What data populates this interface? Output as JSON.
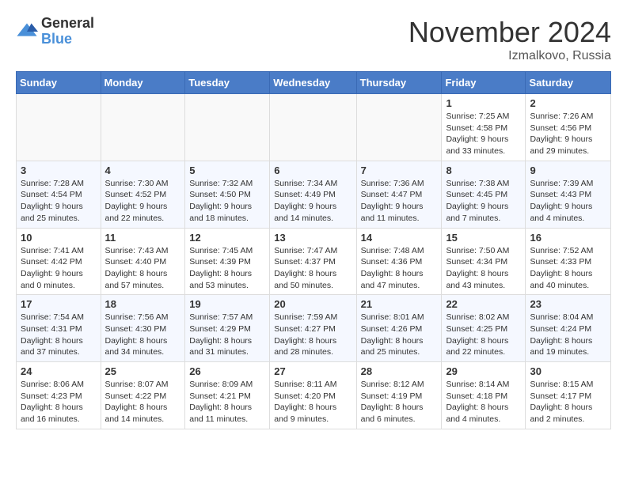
{
  "logo": {
    "general": "General",
    "blue": "Blue"
  },
  "title": "November 2024",
  "location": "Izmalkovo, Russia",
  "weekdays": [
    "Sunday",
    "Monday",
    "Tuesday",
    "Wednesday",
    "Thursday",
    "Friday",
    "Saturday"
  ],
  "weeks": [
    [
      {
        "day": "",
        "info": ""
      },
      {
        "day": "",
        "info": ""
      },
      {
        "day": "",
        "info": ""
      },
      {
        "day": "",
        "info": ""
      },
      {
        "day": "",
        "info": ""
      },
      {
        "day": "1",
        "info": "Sunrise: 7:25 AM\nSunset: 4:58 PM\nDaylight: 9 hours and 33 minutes."
      },
      {
        "day": "2",
        "info": "Sunrise: 7:26 AM\nSunset: 4:56 PM\nDaylight: 9 hours and 29 minutes."
      }
    ],
    [
      {
        "day": "3",
        "info": "Sunrise: 7:28 AM\nSunset: 4:54 PM\nDaylight: 9 hours and 25 minutes."
      },
      {
        "day": "4",
        "info": "Sunrise: 7:30 AM\nSunset: 4:52 PM\nDaylight: 9 hours and 22 minutes."
      },
      {
        "day": "5",
        "info": "Sunrise: 7:32 AM\nSunset: 4:50 PM\nDaylight: 9 hours and 18 minutes."
      },
      {
        "day": "6",
        "info": "Sunrise: 7:34 AM\nSunset: 4:49 PM\nDaylight: 9 hours and 14 minutes."
      },
      {
        "day": "7",
        "info": "Sunrise: 7:36 AM\nSunset: 4:47 PM\nDaylight: 9 hours and 11 minutes."
      },
      {
        "day": "8",
        "info": "Sunrise: 7:38 AM\nSunset: 4:45 PM\nDaylight: 9 hours and 7 minutes."
      },
      {
        "day": "9",
        "info": "Sunrise: 7:39 AM\nSunset: 4:43 PM\nDaylight: 9 hours and 4 minutes."
      }
    ],
    [
      {
        "day": "10",
        "info": "Sunrise: 7:41 AM\nSunset: 4:42 PM\nDaylight: 9 hours and 0 minutes."
      },
      {
        "day": "11",
        "info": "Sunrise: 7:43 AM\nSunset: 4:40 PM\nDaylight: 8 hours and 57 minutes."
      },
      {
        "day": "12",
        "info": "Sunrise: 7:45 AM\nSunset: 4:39 PM\nDaylight: 8 hours and 53 minutes."
      },
      {
        "day": "13",
        "info": "Sunrise: 7:47 AM\nSunset: 4:37 PM\nDaylight: 8 hours and 50 minutes."
      },
      {
        "day": "14",
        "info": "Sunrise: 7:48 AM\nSunset: 4:36 PM\nDaylight: 8 hours and 47 minutes."
      },
      {
        "day": "15",
        "info": "Sunrise: 7:50 AM\nSunset: 4:34 PM\nDaylight: 8 hours and 43 minutes."
      },
      {
        "day": "16",
        "info": "Sunrise: 7:52 AM\nSunset: 4:33 PM\nDaylight: 8 hours and 40 minutes."
      }
    ],
    [
      {
        "day": "17",
        "info": "Sunrise: 7:54 AM\nSunset: 4:31 PM\nDaylight: 8 hours and 37 minutes."
      },
      {
        "day": "18",
        "info": "Sunrise: 7:56 AM\nSunset: 4:30 PM\nDaylight: 8 hours and 34 minutes."
      },
      {
        "day": "19",
        "info": "Sunrise: 7:57 AM\nSunset: 4:29 PM\nDaylight: 8 hours and 31 minutes."
      },
      {
        "day": "20",
        "info": "Sunrise: 7:59 AM\nSunset: 4:27 PM\nDaylight: 8 hours and 28 minutes."
      },
      {
        "day": "21",
        "info": "Sunrise: 8:01 AM\nSunset: 4:26 PM\nDaylight: 8 hours and 25 minutes."
      },
      {
        "day": "22",
        "info": "Sunrise: 8:02 AM\nSunset: 4:25 PM\nDaylight: 8 hours and 22 minutes."
      },
      {
        "day": "23",
        "info": "Sunrise: 8:04 AM\nSunset: 4:24 PM\nDaylight: 8 hours and 19 minutes."
      }
    ],
    [
      {
        "day": "24",
        "info": "Sunrise: 8:06 AM\nSunset: 4:23 PM\nDaylight: 8 hours and 16 minutes."
      },
      {
        "day": "25",
        "info": "Sunrise: 8:07 AM\nSunset: 4:22 PM\nDaylight: 8 hours and 14 minutes."
      },
      {
        "day": "26",
        "info": "Sunrise: 8:09 AM\nSunset: 4:21 PM\nDaylight: 8 hours and 11 minutes."
      },
      {
        "day": "27",
        "info": "Sunrise: 8:11 AM\nSunset: 4:20 PM\nDaylight: 8 hours and 9 minutes."
      },
      {
        "day": "28",
        "info": "Sunrise: 8:12 AM\nSunset: 4:19 PM\nDaylight: 8 hours and 6 minutes."
      },
      {
        "day": "29",
        "info": "Sunrise: 8:14 AM\nSunset: 4:18 PM\nDaylight: 8 hours and 4 minutes."
      },
      {
        "day": "30",
        "info": "Sunrise: 8:15 AM\nSunset: 4:17 PM\nDaylight: 8 hours and 2 minutes."
      }
    ]
  ]
}
